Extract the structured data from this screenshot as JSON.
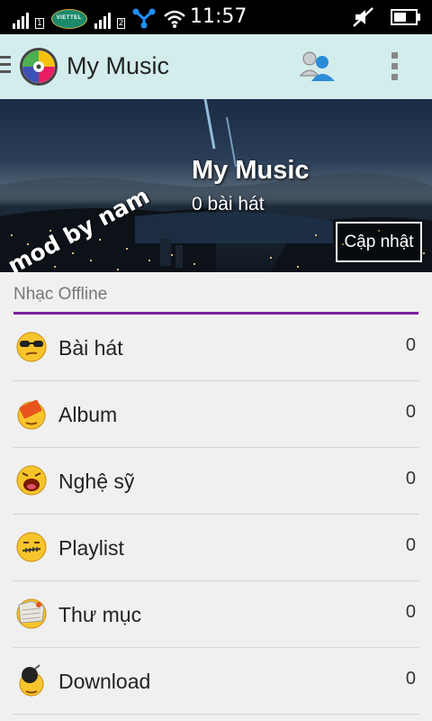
{
  "status_bar": {
    "carrier": "VIETTEL",
    "sim_1": "1",
    "sim_2": "2",
    "clock": "11:57"
  },
  "action_bar": {
    "title": "My Music"
  },
  "banner": {
    "watermark": "mod by nam",
    "title": "My Music",
    "subtitle": "0 bài hát",
    "update_button": "Cập nhật"
  },
  "section": {
    "title": "Nhạc Offline",
    "accent_color": "#7b1fa2"
  },
  "items": [
    {
      "label": "Bài hát",
      "count": "0",
      "icon": "cool-sunglasses-emoji-icon"
    },
    {
      "label": "Album",
      "count": "0",
      "icon": "album-book-emoji-icon"
    },
    {
      "label": "Nghệ sỹ",
      "count": "0",
      "icon": "shouting-emoji-icon"
    },
    {
      "label": "Playlist",
      "count": "0",
      "icon": "zipped-mouth-emoji-icon"
    },
    {
      "label": "Thư mục",
      "count": "0",
      "icon": "folder-emoji-icon"
    },
    {
      "label": "Download",
      "count": "0",
      "icon": "bomb-emoji-icon"
    }
  ]
}
